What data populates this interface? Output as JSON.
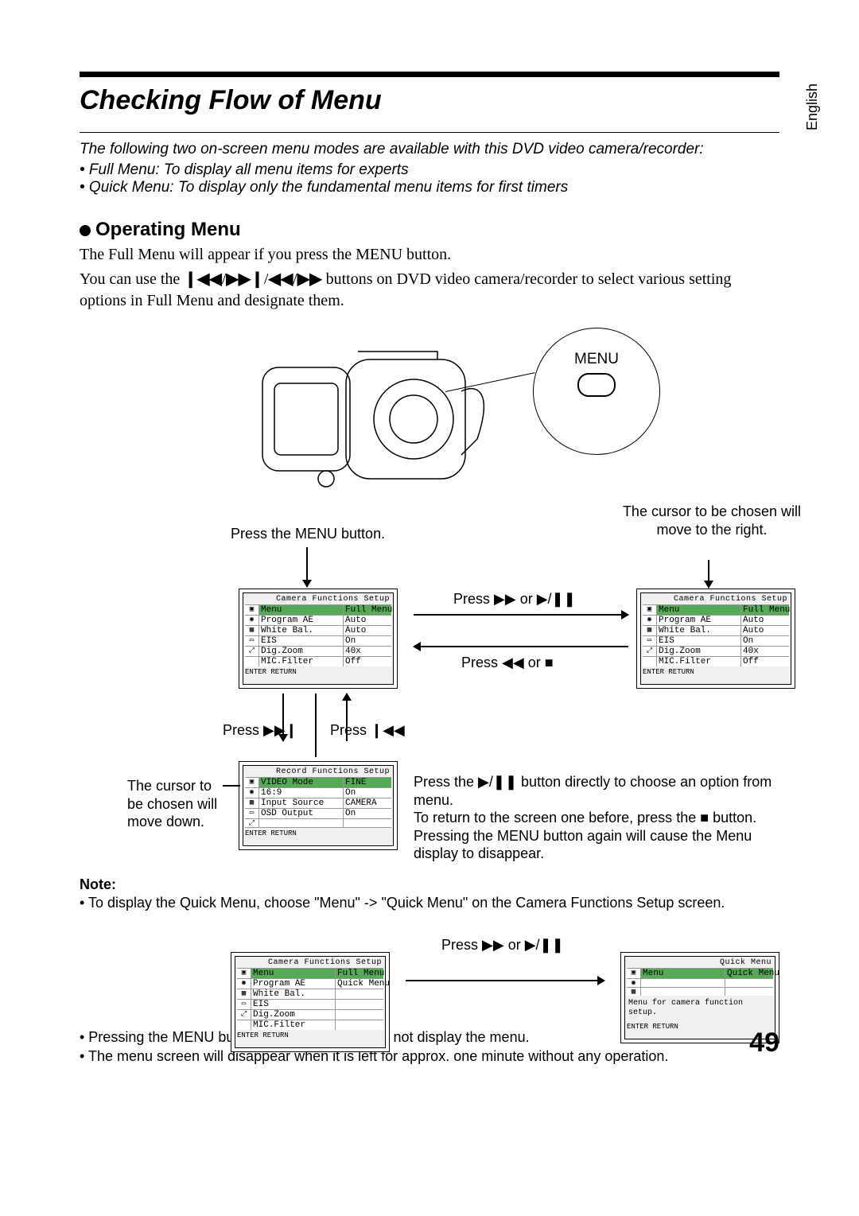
{
  "side_tab": "English",
  "title": "Checking Flow of Menu",
  "intro_line1": "The following two on-screen menu modes are available with this DVD video camera/recorder:",
  "intro_bullet1": "• Full Menu: To display all menu items for experts",
  "intro_bullet2": "• Quick Menu: To display only the fundamental menu items for first timers",
  "section_head": "Operating Menu",
  "body1": "The Full Menu will appear if you press the MENU button.",
  "body2a": "You can use the ",
  "body2b": " buttons on DVD video camera/recorder to select various setting options in Full Menu and designate them.",
  "menu_callout": "MENU",
  "label_press_menu": "Press the MENU button.",
  "label_cursor_right": "The cursor to be chosen will move to the right.",
  "label_press_fwd_or_play": "Press ▶▶ or ▶/❚❚",
  "label_press_rew_or_stop": "Press ◀◀ or ■",
  "label_press_next": "Press ▶▶❙",
  "label_press_prev": "Press ❙◀◀",
  "label_cursor_down": "The cursor to be chosen will move down.",
  "label_press_play_direct_1": "Press the ▶/❚❚ button directly to choose an option from menu.",
  "label_press_play_direct_2": "To return to the screen one before, press the ■ button.",
  "label_press_play_direct_3": "Pressing the MENU button again will cause the Menu display to disappear.",
  "note_head": "Note:",
  "note_bullet1": "• To display the Quick Menu, choose \"Menu\" -> \"Quick Menu\" on the Camera Functions Setup screen.",
  "label_press_fwd_or_play_2": "Press ▶▶ or ▶/❚❚",
  "bottom_bullet1": "• Pressing the MENU button during recording will not display the menu.",
  "bottom_bullet2": "• The menu screen will disappear when it is left for approx. one minute without any operation.",
  "page_num": "49",
  "osd_cam": {
    "title": "Camera Functions Setup",
    "rows": [
      {
        "k": "Menu",
        "v": "Full Menu",
        "hl": true
      },
      {
        "k": "Program AE",
        "v": "Auto"
      },
      {
        "k": "White Bal.",
        "v": "Auto"
      },
      {
        "k": "EIS",
        "v": "On"
      },
      {
        "k": "Dig.Zoom",
        "v": "40x"
      },
      {
        "k": "MIC.Filter",
        "v": "Off"
      }
    ],
    "foot": "ENTER  RETURN"
  },
  "osd_cam2": {
    "title": "Camera Functions Setup",
    "rows": [
      {
        "k": "Menu",
        "v": "Full Menu",
        "hl": true
      },
      {
        "k": "Program AE",
        "v": "Auto"
      },
      {
        "k": "White Bal.",
        "v": "Auto"
      },
      {
        "k": "EIS",
        "v": "On"
      },
      {
        "k": "Dig.Zoom",
        "v": "40x"
      },
      {
        "k": "MIC.Filter",
        "v": "Off"
      }
    ],
    "foot": "ENTER  RETURN"
  },
  "osd_rec": {
    "title": "Record Functions Setup",
    "rows": [
      {
        "k": "VIDEO Mode",
        "v": "FINE",
        "hl": true
      },
      {
        "k": "16:9",
        "v": "On"
      },
      {
        "k": "Input Source",
        "v": "CAMERA"
      },
      {
        "k": "OSD Output",
        "v": "On"
      },
      {
        "k": "",
        "v": ""
      },
      {
        "k": "",
        "v": ""
      }
    ],
    "foot": "ENTER  RETURN"
  },
  "osd_quick_src": {
    "title": "Camera Functions Setup",
    "rows": [
      {
        "k": "Menu",
        "v": "Full Menu",
        "hl": true
      },
      {
        "k": "Program AE",
        "v": "Quick Menu",
        "sub": true
      },
      {
        "k": "White Bal.",
        "v": ""
      },
      {
        "k": "EIS",
        "v": ""
      },
      {
        "k": "Dig.Zoom",
        "v": ""
      },
      {
        "k": "MIC.Filter",
        "v": ""
      }
    ],
    "foot": "ENTER  RETURN"
  },
  "osd_quick_dst": {
    "title": "Quick Menu",
    "rows": [
      {
        "k": "Menu",
        "v": "Quick Menu",
        "hl": true
      },
      {
        "k": "",
        "v": ""
      },
      {
        "k": "",
        "v": ""
      }
    ],
    "msg": "Menu for camera function setup.",
    "foot": "ENTER  RETURN"
  }
}
